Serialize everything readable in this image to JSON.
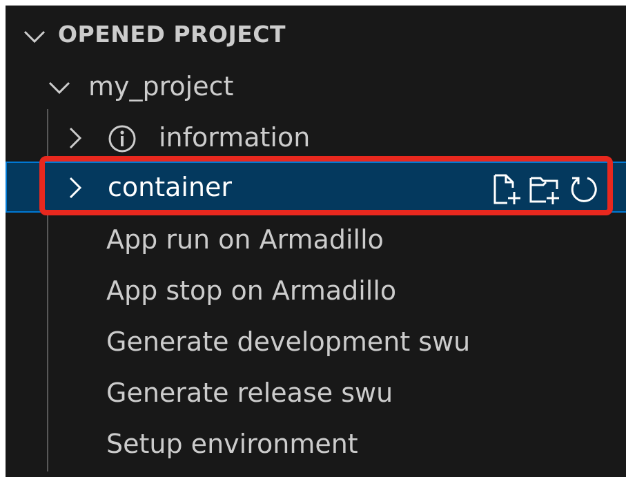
{
  "section": {
    "title": "OPENED PROJECT",
    "expanded": true,
    "chevron_icon": "chevron-down-icon"
  },
  "project": {
    "name": "my_project",
    "expanded": true
  },
  "tree_items": [
    {
      "label": "information",
      "icon": "info-icon",
      "collapsible": true,
      "selected": false
    },
    {
      "label": "container",
      "collapsible": true,
      "selected": true,
      "actions": [
        {
          "name": "new-file-icon"
        },
        {
          "name": "new-folder-icon"
        },
        {
          "name": "refresh-icon"
        }
      ]
    },
    {
      "label": "App run on Armadillo"
    },
    {
      "label": "App stop on Armadillo"
    },
    {
      "label": "Generate development swu"
    },
    {
      "label": "Generate release swu"
    },
    {
      "label": "Setup environment"
    }
  ],
  "colors": {
    "background": "#181818",
    "selected_background": "#04395e",
    "focus_border": "#0078d4",
    "highlight_annotation": "#e8281e",
    "text": "#cccccc"
  }
}
